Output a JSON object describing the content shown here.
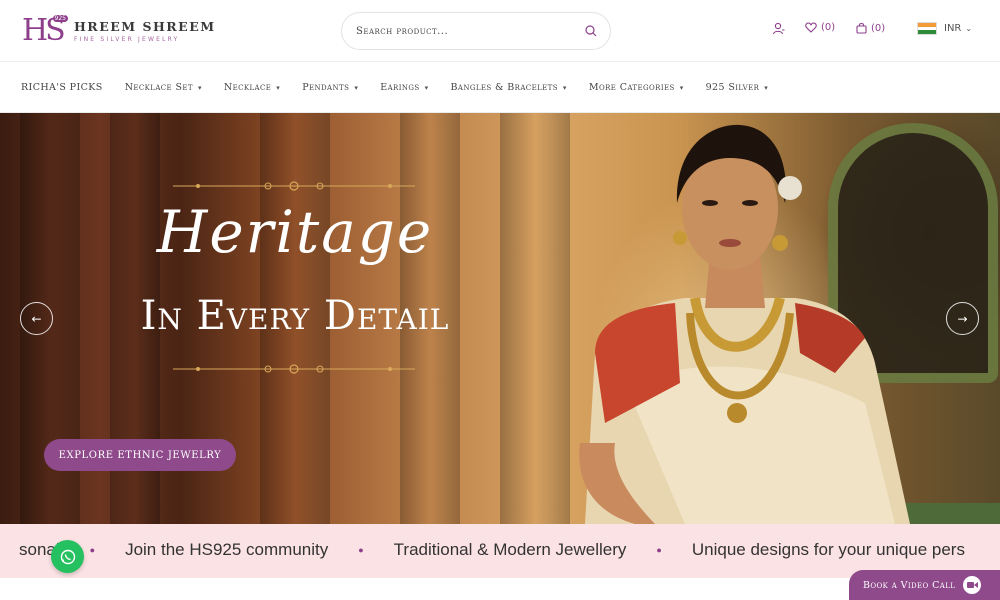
{
  "brand": {
    "mark": "HS",
    "badge": "925",
    "name": "HREEM SHREEM",
    "tagline": "FINE SILVER JEWELRY"
  },
  "search": {
    "placeholder": "Search product..."
  },
  "header_actions": {
    "wishlist_count": "(0)",
    "cart_count": "(0)",
    "currency": "INR"
  },
  "nav": {
    "items": [
      {
        "label": "RICHA'S PICKS",
        "dropdown": false
      },
      {
        "label": "Necklace Set",
        "dropdown": true
      },
      {
        "label": "Necklace",
        "dropdown": true
      },
      {
        "label": "Pendants",
        "dropdown": true
      },
      {
        "label": "Earings",
        "dropdown": true
      },
      {
        "label": "Bangles & Bracelets",
        "dropdown": true
      },
      {
        "label": "More Categories",
        "dropdown": true
      },
      {
        "label": "925 Silver",
        "dropdown": true
      }
    ]
  },
  "hero": {
    "script_title": "Heritage",
    "main_title": "In Every Detail",
    "cta_label": "EXPLORE ETHNIC JEWELRY",
    "prev_icon": "←",
    "next_icon": "→"
  },
  "marquee": {
    "items": [
      "sonal",
      "Join the HS925 community",
      "Traditional & Modern Jewellery",
      "Unique designs for your unique pers"
    ]
  },
  "video_call": {
    "label": "Book a Video Call"
  },
  "colors": {
    "brand_purple": "#8e3f8c",
    "cta_purple": "#8e4a8a",
    "marquee_bg": "#fbe2e4",
    "whatsapp_green": "#25c060"
  }
}
